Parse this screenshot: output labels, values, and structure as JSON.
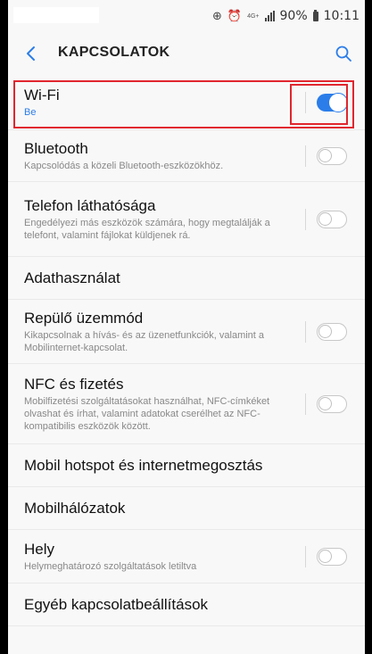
{
  "status_bar": {
    "battery": "90%",
    "time": "10:11",
    "network": "4G+",
    "icons": [
      "data-saver-icon",
      "alarm-icon",
      "signal-icon",
      "battery-icon"
    ]
  },
  "header": {
    "title": "KAPCSOLATOK",
    "back_icon": "chevron-left-icon",
    "search_icon": "search-icon"
  },
  "colors": {
    "accent": "#2b7de9",
    "highlight": "#e0262e"
  },
  "settings": [
    {
      "title": "Wi-Fi",
      "subtitle": "Be",
      "toggle": true,
      "on": true
    },
    {
      "title": "Bluetooth",
      "subtitle": "Kapcsolódás a közeli Bluetooth-eszközökhöz.",
      "toggle": true,
      "on": false
    },
    {
      "title": "Telefon láthatósága",
      "subtitle": "Engedélyezi más eszközök számára, hogy megtalálják a telefont, valamint fájlokat küldjenek rá.",
      "toggle": true,
      "on": false
    },
    {
      "title": "Adathasználat",
      "subtitle": "",
      "toggle": false
    },
    {
      "title": "Repülő üzemmód",
      "subtitle": "Kikapcsolnak a hívás- és az üzenetfunkciók, valamint a Mobilinternet-kapcsolat.",
      "toggle": true,
      "on": false
    },
    {
      "title": "NFC és fizetés",
      "subtitle": "Mobilfizetési szolgáltatásokat használhat, NFC-címkéket olvashat és írhat, valamint adatokat cserélhet az NFC-kompatibilis eszközök között.",
      "toggle": true,
      "on": false
    },
    {
      "title": "Mobil hotspot és internetmegosztás",
      "subtitle": "",
      "toggle": false
    },
    {
      "title": "Mobilhálózatok",
      "subtitle": "",
      "toggle": false
    },
    {
      "title": "Hely",
      "subtitle": "Helymeghatározó szolgáltatások letiltva",
      "toggle": true,
      "on": false
    },
    {
      "title": "Egyéb kapcsolatbeállítások",
      "subtitle": "",
      "toggle": false
    }
  ]
}
